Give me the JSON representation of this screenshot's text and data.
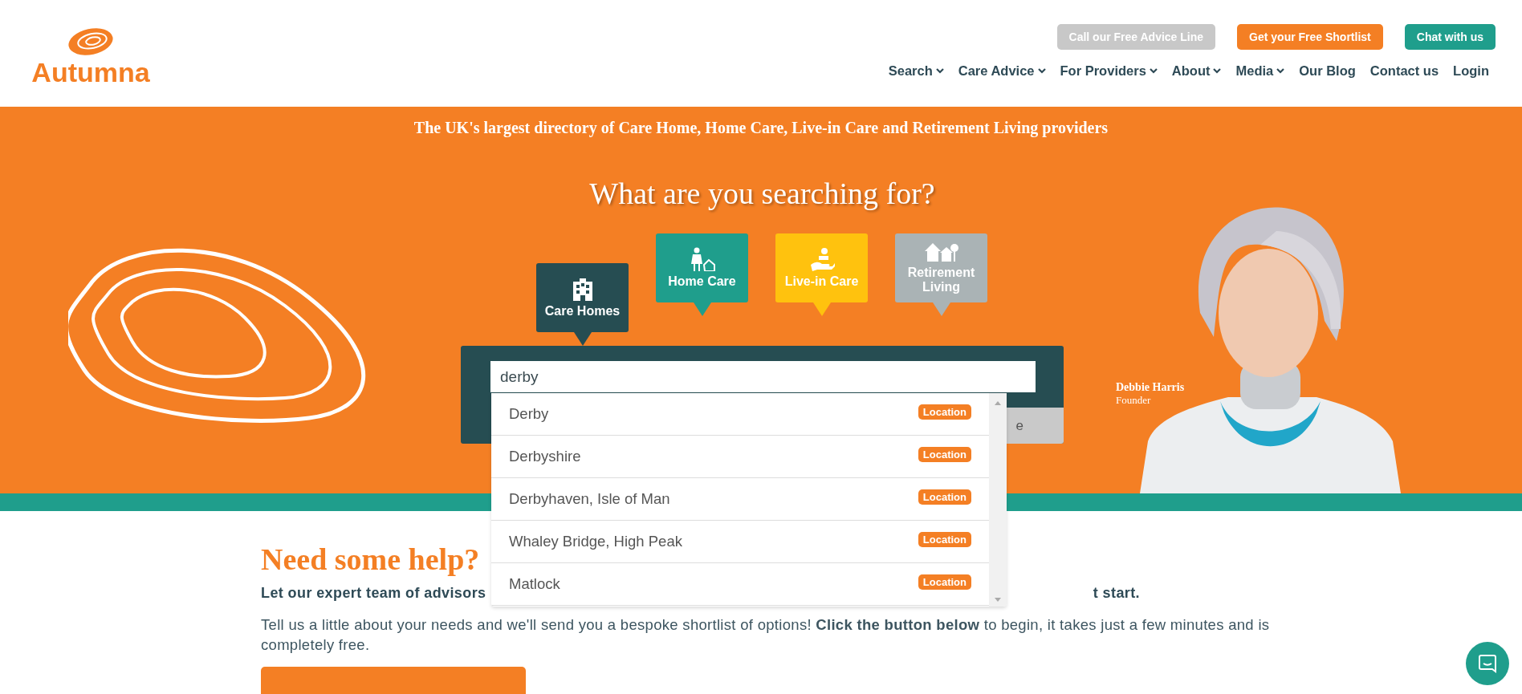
{
  "logo": {
    "text": "Autumna"
  },
  "header_buttons": [
    {
      "label": "Call our Free Advice Line",
      "color": "#c8c8c8"
    },
    {
      "label": "Get your Free Shortlist",
      "color": "#f47f24"
    },
    {
      "label": "Chat with us",
      "color": "#1f9e8c"
    }
  ],
  "nav": [
    {
      "label": "Search",
      "has_menu": true
    },
    {
      "label": "Care Advice",
      "has_menu": true
    },
    {
      "label": "For Providers",
      "has_menu": true
    },
    {
      "label": "About",
      "has_menu": true
    },
    {
      "label": "Media",
      "has_menu": true
    },
    {
      "label": "Our Blog",
      "has_menu": false
    },
    {
      "label": "Contact us",
      "has_menu": false
    },
    {
      "label": "Login",
      "has_menu": false
    }
  ],
  "hero": {
    "tagline": "The UK's largest directory of Care Home, Home Care, Live-in Care and Retirement Living providers",
    "heading": "What are you searching for?",
    "tabs": [
      {
        "label": "Care Homes",
        "kind": "building",
        "color": "#264d52",
        "selected": true
      },
      {
        "label": "Home Care",
        "kind": "carer",
        "color": "#1f9e8c",
        "selected": false
      },
      {
        "label": "Live-in Care",
        "kind": "hand",
        "color": "#ffc20e",
        "selected": false
      },
      {
        "label": "Retirement Living",
        "kind": "houses",
        "color": "#aab3b5",
        "selected": false
      }
    ],
    "search": {
      "value": "derby",
      "button": "e"
    },
    "suggestions": [
      {
        "name": "Derby",
        "badge": "Location"
      },
      {
        "name": "Derbyshire",
        "badge": "Location"
      },
      {
        "name": "Derbyhaven, Isle of Man",
        "badge": "Location"
      },
      {
        "name": "Whaley Bridge, High Peak",
        "badge": "Location"
      },
      {
        "name": "Matlock",
        "badge": "Location"
      }
    ],
    "person": {
      "name": "Debbie Harris",
      "role": "Founder"
    }
  },
  "help": {
    "title": "Need some help?",
    "lead_start": "Let our expert team of advisors",
    "lead_end": "t start.",
    "body": "Tell us a little about your needs and we'll send you a bespoke shortlist of options! **Click the button below** to begin, it takes just a few minutes and is completely free."
  }
}
